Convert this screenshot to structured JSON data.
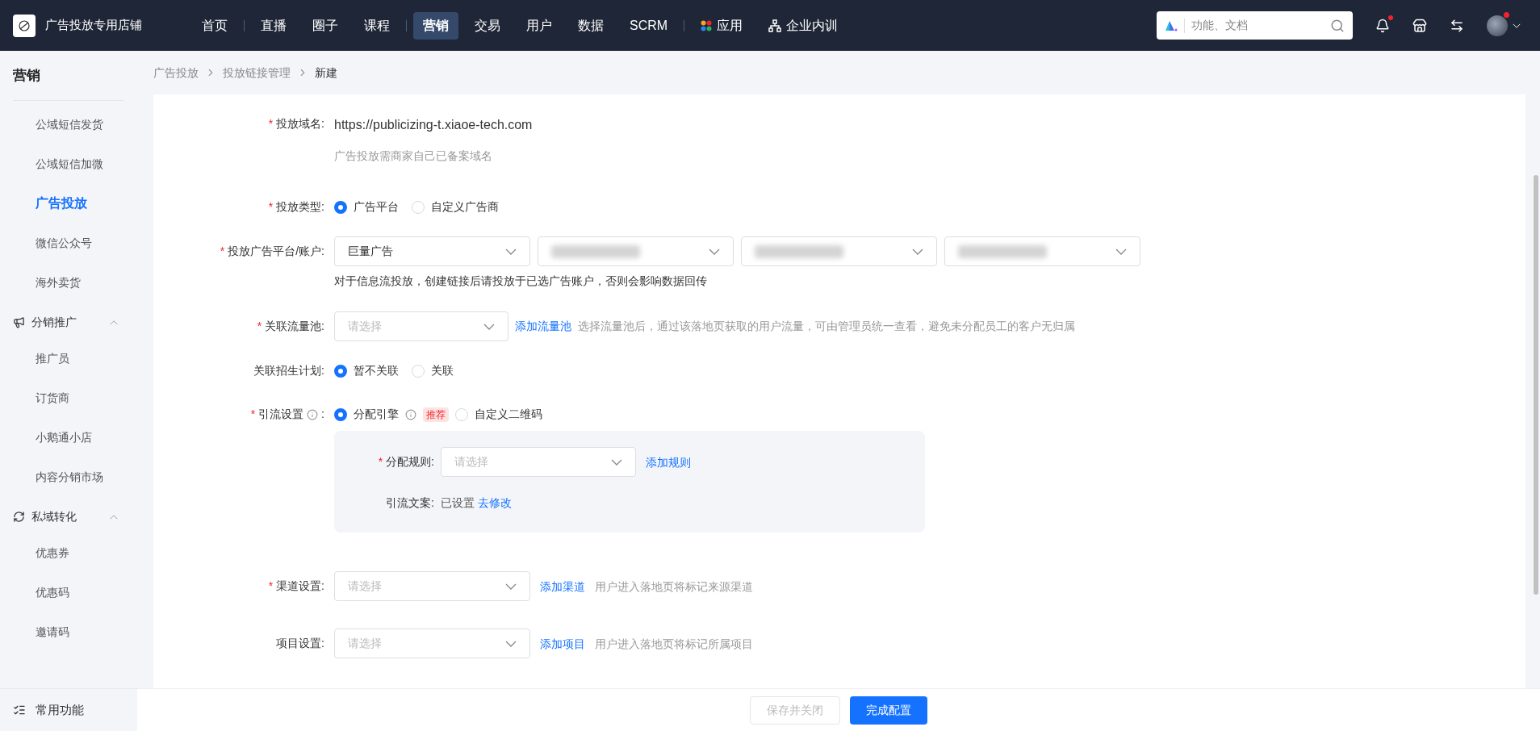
{
  "topbar": {
    "shop_name": "广告投放专用店铺",
    "nav_groups": [
      [
        {
          "label": "首页",
          "selected": false
        }
      ],
      [
        {
          "label": "直播",
          "selected": false
        },
        {
          "label": "圈子",
          "selected": false
        },
        {
          "label": "课程",
          "selected": false
        }
      ],
      [
        {
          "label": "营销",
          "selected": true
        },
        {
          "label": "交易",
          "selected": false
        },
        {
          "label": "用户",
          "selected": false
        },
        {
          "label": "数据",
          "selected": false
        },
        {
          "label": "SCRM",
          "selected": false
        }
      ],
      [
        {
          "label": "应用",
          "selected": false,
          "kind": "apps"
        },
        {
          "label": "企业内训",
          "selected": false,
          "kind": "training"
        }
      ]
    ],
    "search": {
      "placeholder": "功能、文档"
    },
    "notification_badge": true,
    "avatar_badge": true
  },
  "sidebar": {
    "title": "营销",
    "groups": [
      {
        "kind": "plain",
        "items": [
          {
            "label": "公域短信发货",
            "selected": false
          },
          {
            "label": "公域短信加微",
            "selected": false
          },
          {
            "label": "广告投放",
            "selected": true
          },
          {
            "label": "微信公众号",
            "selected": false
          },
          {
            "label": "海外卖货",
            "selected": false
          }
        ]
      },
      {
        "kind": "section",
        "label": "分销推广",
        "expanded": true,
        "items": [
          {
            "label": "推广员",
            "selected": false
          },
          {
            "label": "订货商",
            "selected": false
          },
          {
            "label": "小鹅通小店",
            "selected": false
          },
          {
            "label": "内容分销市场",
            "selected": false
          }
        ]
      },
      {
        "kind": "section",
        "label": "私域转化",
        "expanded": true,
        "items": [
          {
            "label": "优惠券",
            "selected": false
          },
          {
            "label": "优惠码",
            "selected": false
          },
          {
            "label": "邀请码",
            "selected": false
          }
        ]
      }
    ],
    "footer": "常用功能"
  },
  "breadcrumb": [
    "广告投放",
    "投放链接管理",
    "新建"
  ],
  "form": {
    "domain": {
      "label": "投放域名:",
      "required_mark": "*",
      "value": "https://publicizing-t.xiaoe-tech.com",
      "hint": "广告投放需商家自己已备案域名"
    },
    "type": {
      "label": "投放类型:",
      "required_mark": "*",
      "options": [
        {
          "label": "广告平台",
          "selected": true
        },
        {
          "label": "自定义广告商",
          "selected": false
        }
      ]
    },
    "platform": {
      "label": "投放广告平台/账户:",
      "required_mark": "*",
      "selects": [
        {
          "kind": "value",
          "value": "巨量广告"
        },
        {
          "kind": "blurred"
        },
        {
          "kind": "blurred"
        },
        {
          "kind": "blurred"
        }
      ],
      "note": "对于信息流投放，创建链接后请投放于已选广告账户，否则会影响数据回传"
    },
    "pool": {
      "label": "关联流量池:",
      "required_mark": "*",
      "placeholder": "请选择",
      "link": "添加流量池",
      "hint": "选择流量池后，通过该落地页获取的用户流量，可由管理员统一查看，避免未分配员工的客户无归属"
    },
    "plan": {
      "label": "关联招生计划:",
      "options": [
        {
          "label": "暂不关联",
          "selected": true
        },
        {
          "label": "关联",
          "selected": false
        }
      ]
    },
    "traffic": {
      "label": "引流设置",
      "colon": ":",
      "required_mark": "*",
      "options": [
        {
          "label": "分配引擎",
          "selected": true,
          "info": true,
          "badge": "推荐"
        },
        {
          "label": "自定义二维码",
          "selected": false,
          "info": false
        }
      ],
      "rule": {
        "label": "分配规则:",
        "required_mark": "*",
        "placeholder": "请选择",
        "link": "添加规则"
      },
      "copy": {
        "label": "引流文案:",
        "status": "已设置",
        "link": "去修改"
      }
    },
    "channel": {
      "label": "渠道设置:",
      "required_mark": "*",
      "placeholder": "请选择",
      "link": "添加渠道",
      "hint": "用户进入落地页将标记来源渠道"
    },
    "project": {
      "label": "项目设置:",
      "placeholder": "请选择",
      "link": "添加项目",
      "hint": "用户进入落地页将标记所属项目"
    }
  },
  "footer_buttons": [
    {
      "label": "保存并关闭",
      "disabled": true
    },
    {
      "label": "完成配置",
      "disabled": false
    }
  ]
}
